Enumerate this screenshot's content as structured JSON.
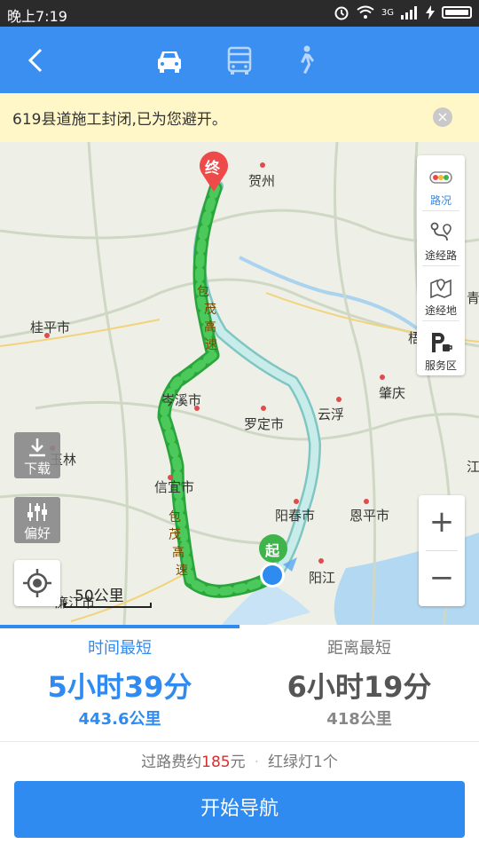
{
  "status_bar": {
    "time": "晚上7:19",
    "network": "3G",
    "icons": [
      "alarm-icon",
      "wifi-icon",
      "signal-icon",
      "charging-icon",
      "battery-icon"
    ]
  },
  "header": {
    "back_icon": "chevron-left-icon",
    "modes": [
      "car-icon",
      "bus-icon",
      "walk-icon"
    ],
    "selected_mode": "car-icon"
  },
  "notice": {
    "text": "619县道施工封闭,已为您避开。",
    "close_icon": "close-icon"
  },
  "map": {
    "cities": [
      "贺州",
      "桂平市",
      "岑溪市",
      "罗定市",
      "云浮",
      "肇庆",
      "玉林",
      "信宜市",
      "阳春市",
      "恩平市",
      "阳江",
      "廉江市",
      "梧州",
      "青",
      "江"
    ],
    "highway_labels": {
      "upper": [
        "包",
        "茂",
        "高",
        "速"
      ],
      "lower": [
        "包",
        "茂",
        "高",
        "速"
      ]
    },
    "end_marker": "终",
    "start_marker": "起",
    "scale_label": "50公里"
  },
  "right_panel": [
    {
      "label": "路况",
      "icon": "traffic-icon",
      "active": true
    },
    {
      "label": "途经路",
      "icon": "waypoint-road-icon",
      "active": false
    },
    {
      "label": "途经地",
      "icon": "waypoint-place-icon",
      "active": false
    },
    {
      "label": "服务区",
      "icon": "service-area-icon",
      "active": false
    }
  ],
  "left_buttons": {
    "download": "下载",
    "preference": "偏好"
  },
  "zoom": {
    "in": "+",
    "out": "−"
  },
  "routes": [
    {
      "tag": "时间最短",
      "duration": "5小时39分",
      "distance": "443.6公里",
      "selected": true
    },
    {
      "tag": "距离最短",
      "duration": "6小时19分",
      "distance": "418公里",
      "selected": false
    }
  ],
  "trip_info": {
    "toll_prefix": "过路费约",
    "toll_amount": "185",
    "toll_suffix": "元",
    "lights": "红绿灯1个"
  },
  "start_button": "开始导航",
  "colors": {
    "accent": "#3a8ff0",
    "route_green": "#3dbb4a",
    "route_alt": "#b8e4e2",
    "price_red": "#d43030",
    "notice_bg": "#fff7c8"
  }
}
